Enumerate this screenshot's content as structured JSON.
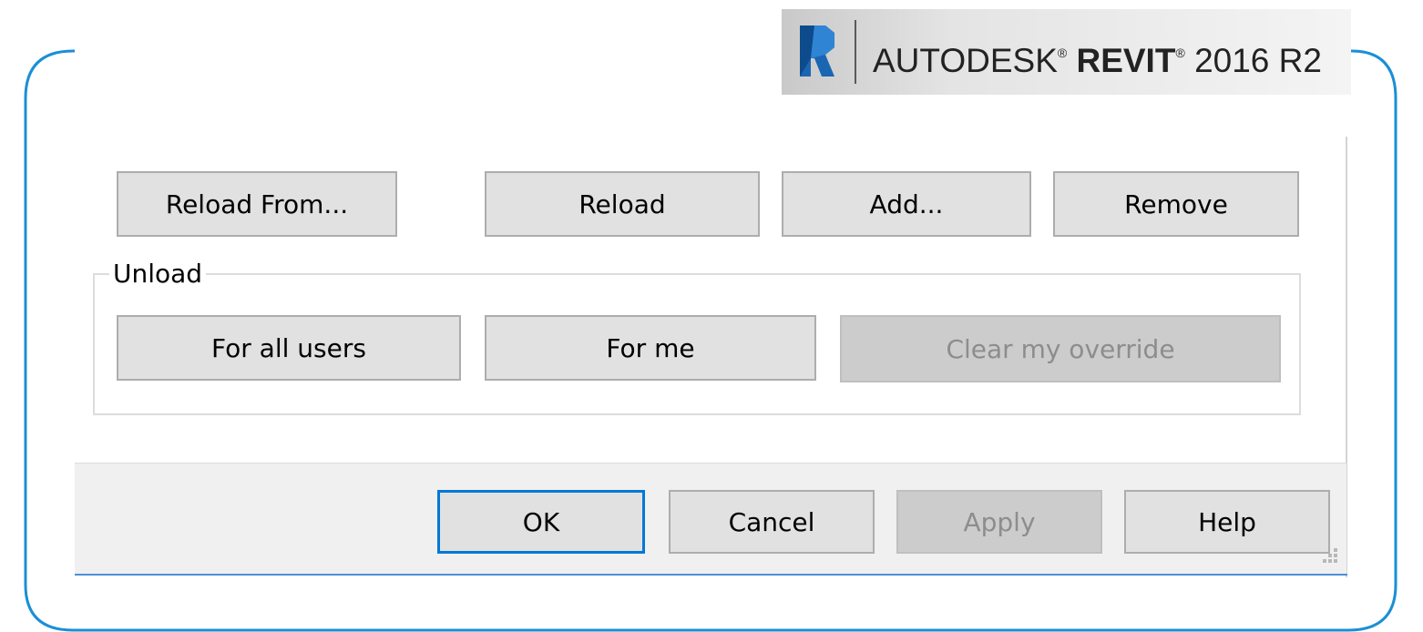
{
  "brand": {
    "vendor": "AUTODESK",
    "vendor_mark": "®",
    "product": "REVIT",
    "product_mark": "®",
    "version": "2016 R2",
    "logo_icon": "revit-r-logo-icon",
    "logo_color": "#1a66b3"
  },
  "actions": {
    "reload_from": "Reload From...",
    "reload": "Reload",
    "add": "Add...",
    "remove": "Remove"
  },
  "unload_group": {
    "label": "Unload",
    "for_all_users": "For all users",
    "for_me": "For me",
    "clear_my_override": "Clear my override",
    "clear_my_override_enabled": false
  },
  "footer": {
    "ok": "OK",
    "cancel": "Cancel",
    "apply": "Apply",
    "apply_enabled": false,
    "help": "Help"
  },
  "colors": {
    "frame_stroke": "#1a8fd6",
    "default_button_border": "#0078d7",
    "button_face": "#e1e1e1",
    "disabled_face": "#cccccc",
    "disabled_text": "#8d8d8d"
  }
}
